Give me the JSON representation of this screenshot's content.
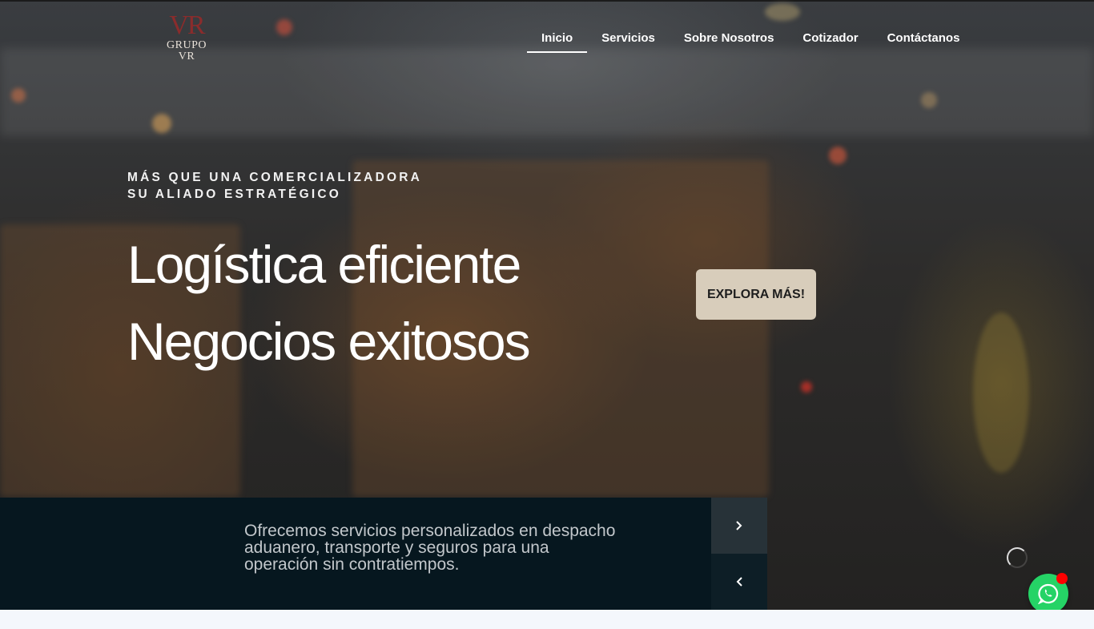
{
  "brand": {
    "mark": "VR",
    "name": "GRUPO VR",
    "mark_color": "#8a2c2c"
  },
  "nav": {
    "items": [
      {
        "label": "Inicio",
        "active": true
      },
      {
        "label": "Servicios",
        "active": false
      },
      {
        "label": "Sobre Nosotros",
        "active": false
      },
      {
        "label": "Cotizador",
        "active": false
      },
      {
        "label": "Contáctanos",
        "active": false
      }
    ]
  },
  "hero": {
    "eyebrow_line1": "MÁS QUE UNA COMERCIALIZADORA",
    "eyebrow_line2": "SU ALIADO ESTRATÉGICO",
    "headline_line1": "Logística eficiente",
    "headline_line2": "Negocios exitosos",
    "cta_label": "EXPLORA MÁS!",
    "cta_color": "#d8cdbb"
  },
  "info_bar": {
    "text": "Ofrecemos servicios personalizados en despacho aduanero, transporte y seguros para una operación sin contratiempos.",
    "background": "#06171f",
    "next_icon": "chevron-right-icon",
    "prev_icon": "chevron-left-icon"
  },
  "floating": {
    "whatsapp_icon": "whatsapp-icon",
    "whatsapp_color": "#25d366",
    "badge_color": "#ff0000"
  }
}
